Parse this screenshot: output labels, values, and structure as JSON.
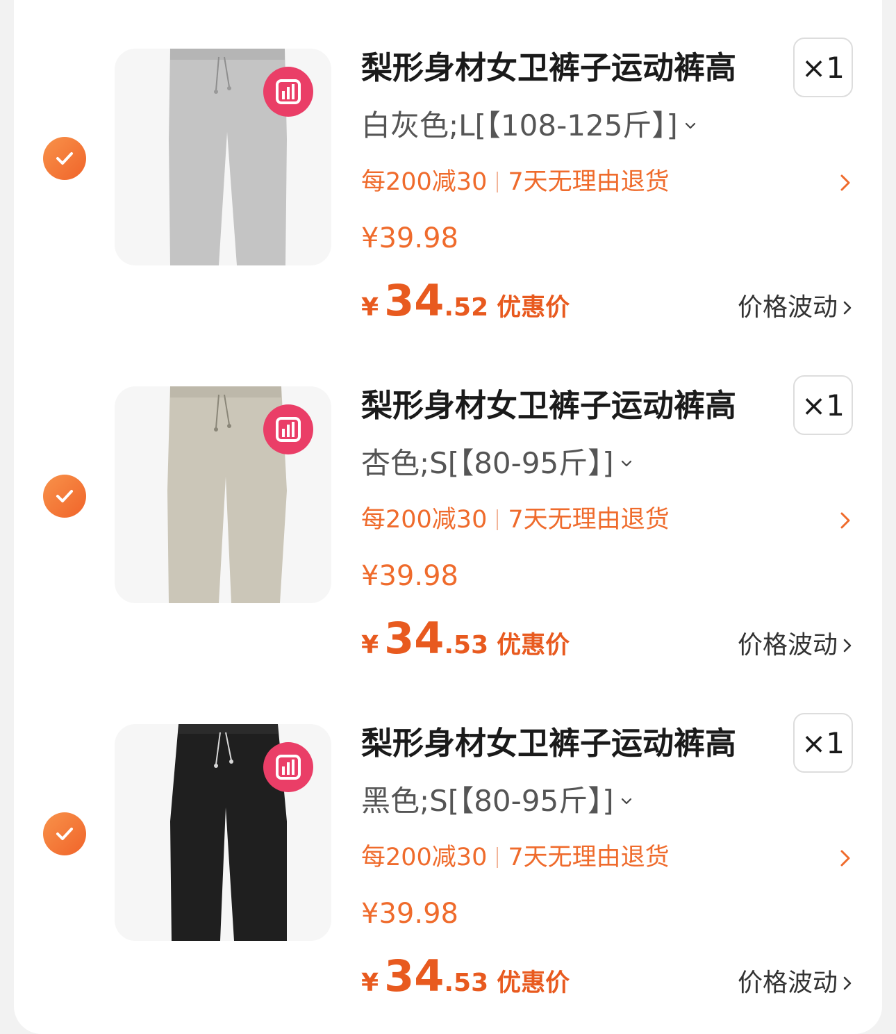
{
  "colors": {
    "accent": "#ef6b2c",
    "price": "#e85a1f",
    "badge": "#ea3e67"
  },
  "items": [
    {
      "title": "梨形身材女卫裤子运动裤高",
      "quantity": "×1",
      "sku": "白灰色;L[【108-125斤】]",
      "promo_discount": "每200减30",
      "promo_return": "7天无理由退货",
      "original_price": "¥39.98",
      "final_currency": "¥",
      "final_int": "34",
      "final_dec": ".52",
      "final_tag": "优惠价",
      "trend_label": "价格波动",
      "image_color": "#bebebe",
      "image_icon": "gray-pants-image"
    },
    {
      "title": "梨形身材女卫裤子运动裤高",
      "quantity": "×1",
      "sku": "杏色;S[【80-95斤】]",
      "promo_discount": "每200减30",
      "promo_return": "7天无理由退货",
      "original_price": "¥39.98",
      "final_currency": "¥",
      "final_int": "34",
      "final_dec": ".53",
      "final_tag": "优惠价",
      "trend_label": "价格波动",
      "image_color": "#c9c4b6",
      "image_icon": "beige-pants-image"
    },
    {
      "title": "梨形身材女卫裤子运动裤高",
      "quantity": "×1",
      "sku": "黑色;S[【80-95斤】]",
      "promo_discount": "每200减30",
      "promo_return": "7天无理由退货",
      "original_price": "¥39.98",
      "final_currency": "¥",
      "final_int": "34",
      "final_dec": ".53",
      "final_tag": "优惠价",
      "trend_label": "价格波动",
      "image_color": "#1e1e1e",
      "image_icon": "black-pants-image"
    }
  ]
}
